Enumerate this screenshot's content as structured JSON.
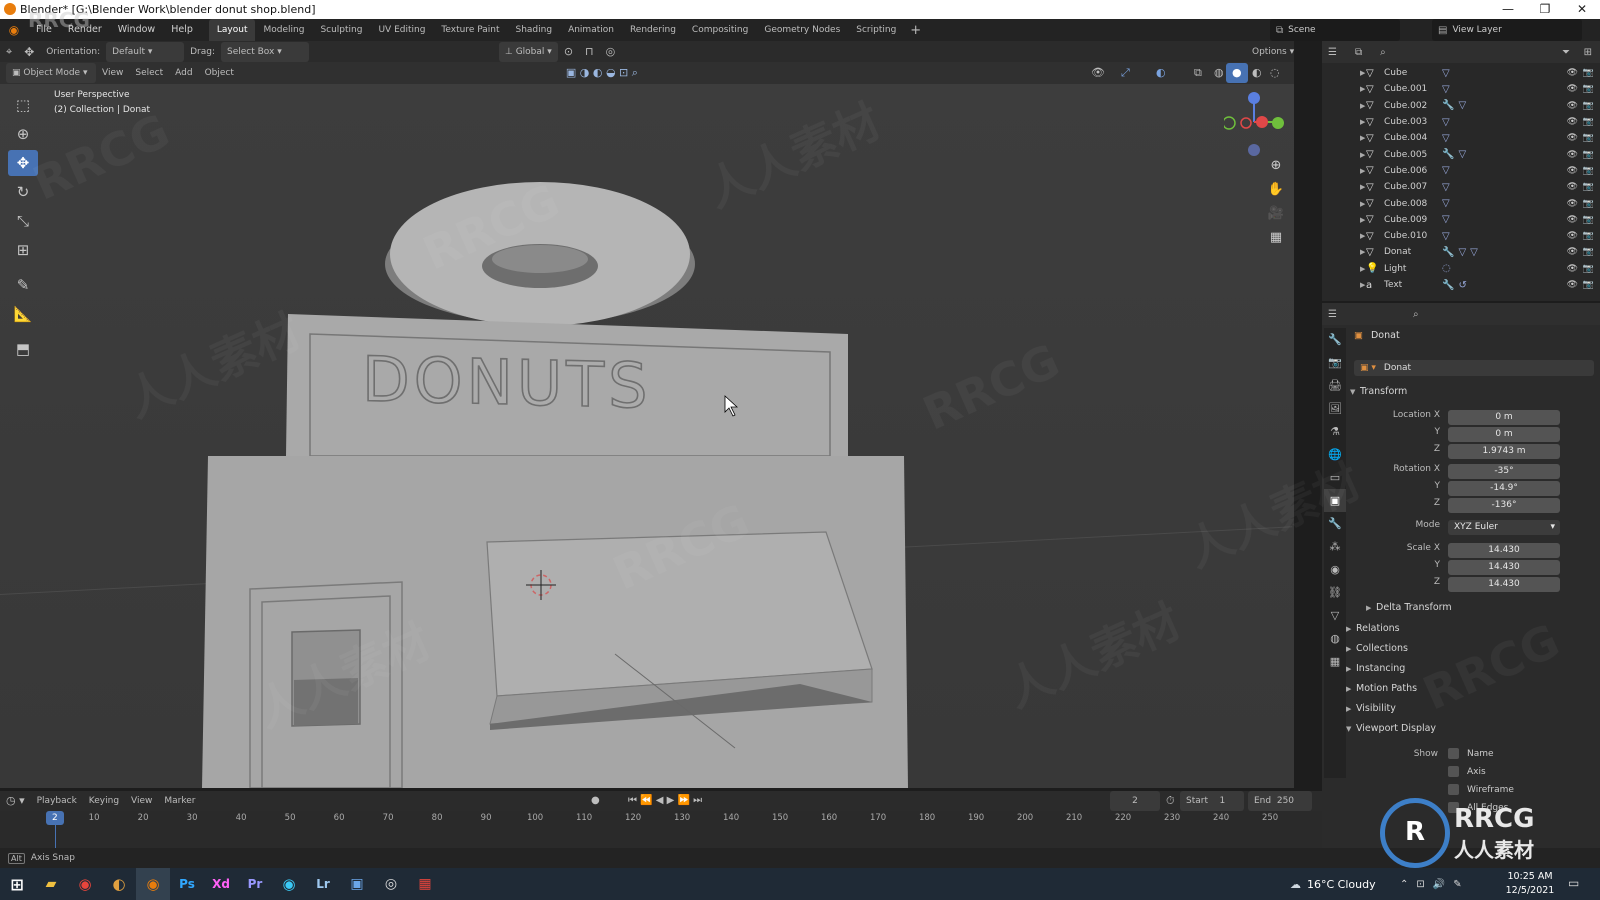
{
  "window": {
    "title": "Blender* [G:\\Blender Work\\blender donut shop.blend]"
  },
  "menus": [
    "File",
    "Render",
    "Window",
    "Help"
  ],
  "workspaces": [
    "Layout",
    "Modeling",
    "Sculpting",
    "UV Editing",
    "Texture Paint",
    "Shading",
    "Animation",
    "Rendering",
    "Compositing",
    "Geometry Nodes",
    "Scripting"
  ],
  "active_workspace": "Layout",
  "scene": {
    "scene_label": "Scene",
    "view_layer_label": "View Layer"
  },
  "toolheader": {
    "orientation_label": "Orientation:",
    "orientation_value": "Default",
    "drag_label": "Drag:",
    "drag_value": "Select Box",
    "transform_space": "Global",
    "options_label": "Options"
  },
  "viewport_header": {
    "mode": "Object Mode",
    "menu": [
      "View",
      "Select",
      "Add",
      "Object"
    ]
  },
  "viewport": {
    "perspective": "User Perspective",
    "collection_info": "(2) Collection | Donat",
    "sign_text": "DONUTS"
  },
  "outliner": {
    "items": [
      {
        "name": "Cube",
        "icon": "mesh-icon",
        "mods": [
          "mesh-data-icon"
        ]
      },
      {
        "name": "Cube.001",
        "icon": "mesh-icon",
        "mods": [
          "mesh-data-icon"
        ]
      },
      {
        "name": "Cube.002",
        "icon": "mesh-icon",
        "mods": [
          "wrench-icon",
          "mesh-data-icon"
        ]
      },
      {
        "name": "Cube.003",
        "icon": "mesh-icon",
        "mods": [
          "mesh-data-icon"
        ]
      },
      {
        "name": "Cube.004",
        "icon": "mesh-icon",
        "mods": [
          "mesh-data-icon"
        ]
      },
      {
        "name": "Cube.005",
        "icon": "mesh-icon",
        "mods": [
          "wrench-icon",
          "mesh-data-icon"
        ]
      },
      {
        "name": "Cube.006",
        "icon": "mesh-icon",
        "mods": [
          "mesh-data-icon"
        ]
      },
      {
        "name": "Cube.007",
        "icon": "mesh-icon",
        "mods": [
          "mesh-data-icon"
        ]
      },
      {
        "name": "Cube.008",
        "icon": "mesh-icon",
        "mods": [
          "mesh-data-icon"
        ]
      },
      {
        "name": "Cube.009",
        "icon": "mesh-icon",
        "mods": [
          "mesh-data-icon"
        ]
      },
      {
        "name": "Cube.010",
        "icon": "mesh-icon",
        "mods": [
          "mesh-data-icon"
        ]
      },
      {
        "name": "Donat",
        "icon": "mesh-icon",
        "mods": [
          "wrench-icon",
          "mesh-data-icon",
          "mesh-data-icon"
        ]
      },
      {
        "name": "Light",
        "icon": "light-icon",
        "mods": [
          "light-data-icon"
        ]
      },
      {
        "name": "Text",
        "icon": "text-icon",
        "mods": [
          "wrench-icon",
          "curve-icon"
        ]
      }
    ]
  },
  "properties": {
    "object_name": "Donat",
    "datablock_name": "Donat",
    "transform_label": "Transform",
    "location_label": "Location X",
    "location": [
      "0 m",
      "0 m",
      "1.9743 m"
    ],
    "rotation_label": "Rotation X",
    "rotation": [
      "-35°",
      "-14.9°",
      "-136°"
    ],
    "mode_label": "Mode",
    "mode_value": "XYZ Euler",
    "scale_label": "Scale X",
    "scale": [
      "14.430",
      "14.430",
      "14.430"
    ],
    "axis_y": "Y",
    "axis_z": "Z",
    "delta_label": "Delta Transform",
    "sections": [
      "Relations",
      "Collections",
      "Instancing",
      "Motion Paths",
      "Visibility",
      "Viewport Display"
    ],
    "show_label": "Show",
    "show_options": [
      "Name",
      "Axis",
      "Wireframe",
      "All Edges"
    ]
  },
  "timeline": {
    "menu": [
      "Playback",
      "Keying",
      "View",
      "Marker"
    ],
    "current_frame": "2",
    "start_label": "Start",
    "start": "1",
    "end_label": "End",
    "end": "250",
    "ticks": [
      "10",
      "20",
      "30",
      "40",
      "50",
      "60",
      "70",
      "80",
      "90",
      "100",
      "110",
      "120",
      "130",
      "140",
      "150",
      "160",
      "170",
      "180",
      "190",
      "200",
      "210",
      "220",
      "230",
      "240",
      "250"
    ],
    "playhead_value": "2"
  },
  "statusbar": {
    "text": "Axis Snap"
  },
  "taskbar": {
    "apps": [
      "Ps",
      "Xd",
      "Pr",
      "Lr"
    ],
    "weather": "16°C  Cloudy",
    "time": "10:25 AM",
    "date": "12/5/2021"
  },
  "watermarks": [
    "RRCG",
    "人人素材"
  ],
  "colors": {
    "accent": "#4772b3",
    "brand_orange": "#e87d0d"
  }
}
